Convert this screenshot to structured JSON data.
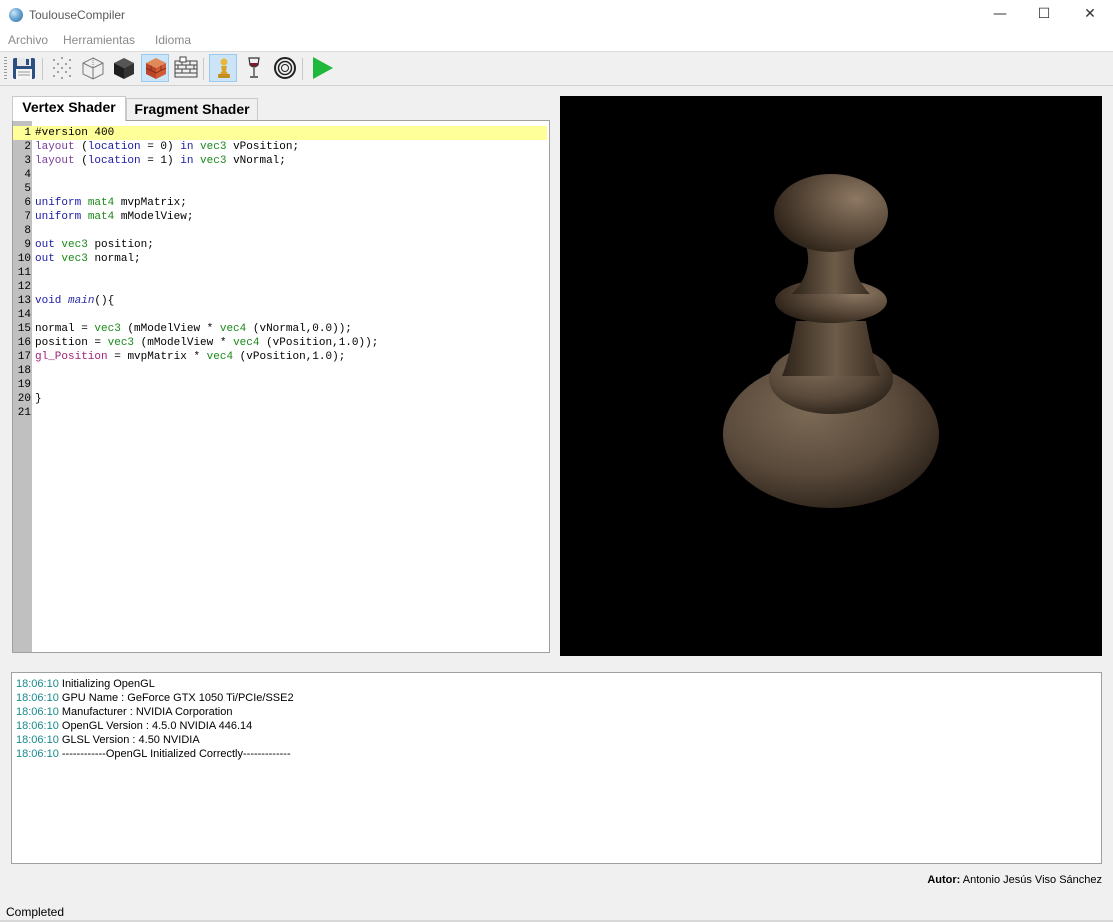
{
  "window": {
    "title": "ToulouseCompiler",
    "minimize_glyph": "—",
    "maximize_glyph": "☐",
    "close_glyph": "✕"
  },
  "menu": {
    "items": [
      "Archivo",
      "Herramientas",
      "Idioma"
    ]
  },
  "toolbar": {
    "icons": [
      "save-icon",
      "points-mode-icon",
      "wireframe-cube-icon",
      "solid-cube-icon",
      "textured-cube-icon",
      "brick-texture-icon",
      "pawn-model-icon",
      "wine-glass-model-icon",
      "torus-model-icon",
      "run-icon"
    ],
    "active": [
      "textured-cube-icon",
      "pawn-model-icon"
    ],
    "run_color": "#1fb83a"
  },
  "tabs": [
    "Vertex Shader",
    "Fragment Shader"
  ],
  "editor": {
    "highlight_color": "#ffff99",
    "lines": [
      "#version 400",
      "layout (location = 0) in vec3 vPosition;",
      "layout (location = 1) in vec3 vNormal;",
      "",
      "",
      "uniform mat4 mvpMatrix;",
      "uniform mat4 mModelView;",
      "",
      "out vec3 position;",
      "out vec3 normal;",
      "",
      "",
      "void main(){",
      "",
      "normal = vec3 (mModelView * vec4 (vNormal,0.0));",
      "position = vec3 (mModelView * vec4 (vPosition,1.0));",
      "gl_Position = mvpMatrix * vec4 (vPosition,1.0);",
      "",
      "",
      "}",
      ""
    ]
  },
  "viewport": {
    "background": "#000000",
    "model": "pawn",
    "model_color": "#6b5a48"
  },
  "log": [
    {
      "time": "18:06:10",
      "message": "Initializing OpenGL"
    },
    {
      "time": "18:06:10",
      "message": "GPU Name : GeForce GTX 1050 Ti/PCIe/SSE2"
    },
    {
      "time": "18:06:10",
      "message": "Manufacturer : NVIDIA Corporation"
    },
    {
      "time": "18:06:10",
      "message": "OpenGL Version : 4.5.0 NVIDIA 446.14"
    },
    {
      "time": "18:06:10",
      "message": "GLSL Version : 4.50 NVIDIA"
    },
    {
      "time": "18:06:10",
      "message": "------------OpenGL Initialized Correctly-------------"
    }
  ],
  "author": {
    "label": "Autor:",
    "name": "Antonio Jesús Viso Sánchez"
  },
  "status": "Completed"
}
